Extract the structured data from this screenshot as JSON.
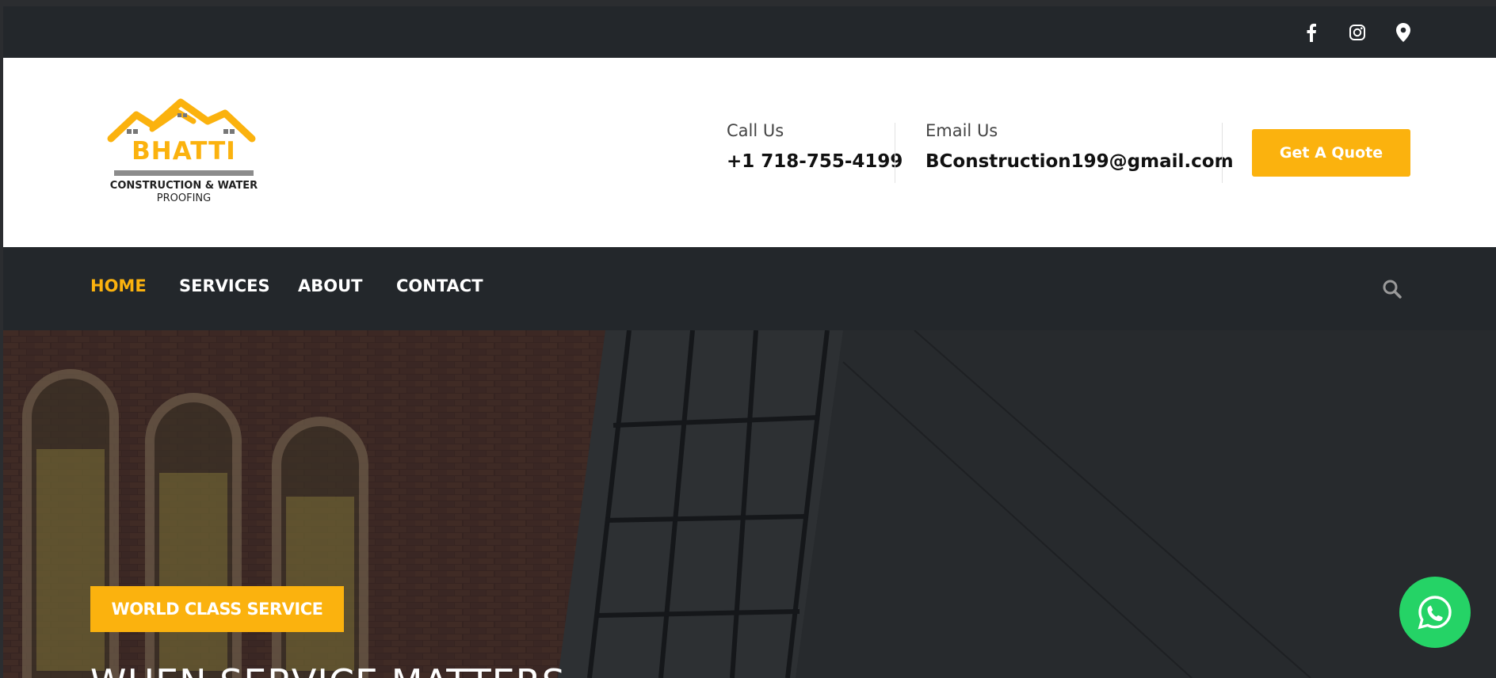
{
  "topbar": {
    "social": [
      {
        "icon": "facebook-icon"
      },
      {
        "icon": "instagram-icon"
      },
      {
        "icon": "location-pin-icon"
      }
    ]
  },
  "header": {
    "logo": {
      "brand": "BHATTI",
      "line1": "CONSTRUCTION & WATER",
      "line2": "PROOFING"
    },
    "call": {
      "label": "Call Us",
      "value": "+1 718-755-4199"
    },
    "email": {
      "label": "Email Us",
      "value": "BConstruction199@gmail.com"
    },
    "quote_label": "Get A Quote"
  },
  "nav": {
    "items": [
      {
        "label": "HOME",
        "active": true
      },
      {
        "label": "SERVICES",
        "active": false
      },
      {
        "label": "ABOUT",
        "active": false
      },
      {
        "label": "CONTACT",
        "active": false
      }
    ],
    "search_icon": "search-icon"
  },
  "hero": {
    "badge": "WORLD CLASS SERVICE",
    "title": "WHEN SERVICE MATTERS"
  },
  "floating": {
    "icon": "whatsapp-icon"
  },
  "colors": {
    "accent": "#fbb20e",
    "dark": "#23272b",
    "whatsapp": "#25d366"
  }
}
